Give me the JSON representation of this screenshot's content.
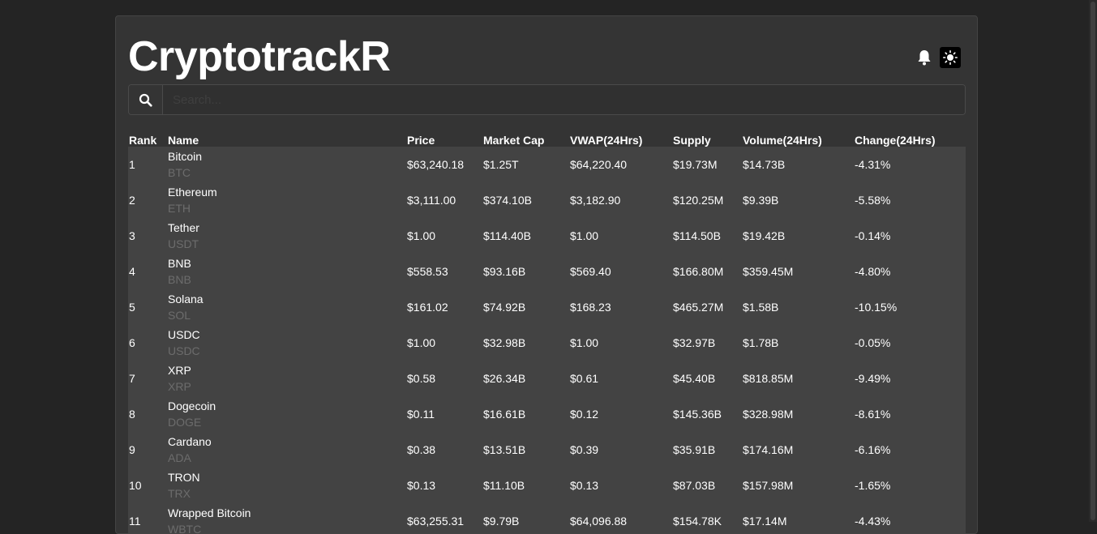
{
  "app": {
    "title": "CryptotrackR"
  },
  "search": {
    "placeholder": "Search..."
  },
  "icons": {
    "bell": "bell-icon",
    "theme": "sun-icon",
    "search": "search-icon"
  },
  "colors": {
    "negative_change": "#ff2020",
    "symbol_text": "#6c6c6c",
    "row_background": "#434343",
    "card_background": "#343434"
  },
  "table": {
    "headers": {
      "rank": "Rank",
      "name": "Name",
      "price": "Price",
      "market_cap": "Market Cap",
      "vwap": "VWAP(24Hrs)",
      "supply": "Supply",
      "volume": "Volume(24Hrs)",
      "change": "Change(24Hrs)"
    },
    "rows": [
      {
        "rank": "1",
        "name": "Bitcoin",
        "symbol": "BTC",
        "price": "$63,240.18",
        "market_cap": "$1.25T",
        "vwap": "$64,220.40",
        "supply": "$19.73M",
        "volume": "$14.73B",
        "change": "-4.31%"
      },
      {
        "rank": "2",
        "name": "Ethereum",
        "symbol": "ETH",
        "price": "$3,111.00",
        "market_cap": "$374.10B",
        "vwap": "$3,182.90",
        "supply": "$120.25M",
        "volume": "$9.39B",
        "change": "-5.58%"
      },
      {
        "rank": "3",
        "name": "Tether",
        "symbol": "USDT",
        "price": "$1.00",
        "market_cap": "$114.40B",
        "vwap": "$1.00",
        "supply": "$114.50B",
        "volume": "$19.42B",
        "change": "-0.14%"
      },
      {
        "rank": "4",
        "name": "BNB",
        "symbol": "BNB",
        "price": "$558.53",
        "market_cap": "$93.16B",
        "vwap": "$569.40",
        "supply": "$166.80M",
        "volume": "$359.45M",
        "change": "-4.80%"
      },
      {
        "rank": "5",
        "name": "Solana",
        "symbol": "SOL",
        "price": "$161.02",
        "market_cap": "$74.92B",
        "vwap": "$168.23",
        "supply": "$465.27M",
        "volume": "$1.58B",
        "change": "-10.15%"
      },
      {
        "rank": "6",
        "name": "USDC",
        "symbol": "USDC",
        "price": "$1.00",
        "market_cap": "$32.98B",
        "vwap": "$1.00",
        "supply": "$32.97B",
        "volume": "$1.78B",
        "change": "-0.05%"
      },
      {
        "rank": "7",
        "name": "XRP",
        "symbol": "XRP",
        "price": "$0.58",
        "market_cap": "$26.34B",
        "vwap": "$0.61",
        "supply": "$45.40B",
        "volume": "$818.85M",
        "change": "-9.49%"
      },
      {
        "rank": "8",
        "name": "Dogecoin",
        "symbol": "DOGE",
        "price": "$0.11",
        "market_cap": "$16.61B",
        "vwap": "$0.12",
        "supply": "$145.36B",
        "volume": "$328.98M",
        "change": "-8.61%"
      },
      {
        "rank": "9",
        "name": "Cardano",
        "symbol": "ADA",
        "price": "$0.38",
        "market_cap": "$13.51B",
        "vwap": "$0.39",
        "supply": "$35.91B",
        "volume": "$174.16M",
        "change": "-6.16%"
      },
      {
        "rank": "10",
        "name": "TRON",
        "symbol": "TRX",
        "price": "$0.13",
        "market_cap": "$11.10B",
        "vwap": "$0.13",
        "supply": "$87.03B",
        "volume": "$157.98M",
        "change": "-1.65%"
      },
      {
        "rank": "11",
        "name": "Wrapped Bitcoin",
        "symbol": "WBTC",
        "price": "$63,255.31",
        "market_cap": "$9.79B",
        "vwap": "$64,096.88",
        "supply": "$154.78K",
        "volume": "$17.14M",
        "change": "-4.43%"
      }
    ]
  }
}
